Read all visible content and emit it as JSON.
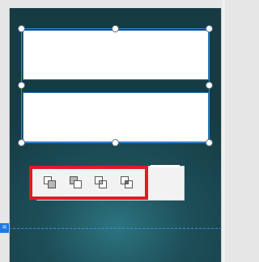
{
  "top_label": "",
  "toolbar": {
    "buttons": [
      {
        "name": "bring-to-front-button",
        "icon": "bring-to-front-icon"
      },
      {
        "name": "send-to-back-button",
        "icon": "send-to-back-icon"
      },
      {
        "name": "bring-forward-button",
        "icon": "bring-forward-icon"
      },
      {
        "name": "send-backward-button",
        "icon": "send-backward-icon"
      }
    ]
  },
  "guide": {
    "marker_glyph": "="
  },
  "colors": {
    "canvas": "#1d4f59",
    "selection": "#3a8ad0",
    "highlight": "#e11b22",
    "guide": "#3b8fd6"
  }
}
